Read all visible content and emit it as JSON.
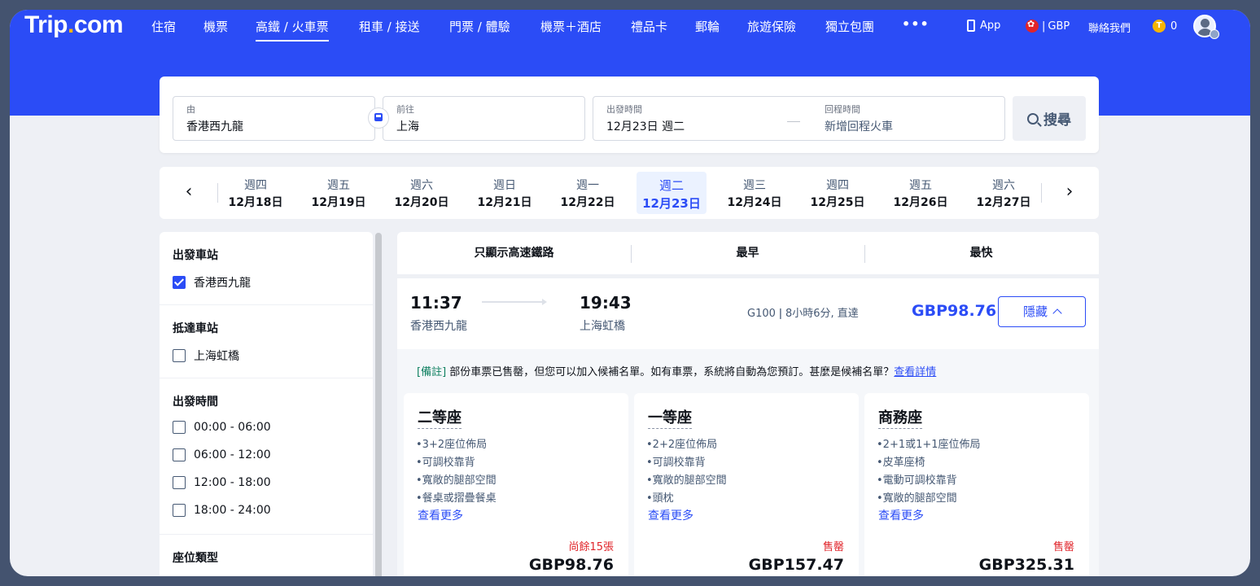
{
  "brand": {
    "name_left": "Trip",
    "name_dot": ".",
    "name_right": "com"
  },
  "nav": {
    "items": [
      {
        "label": "住宿"
      },
      {
        "label": "機票"
      },
      {
        "label": "高鐵 / 火車票",
        "active": true
      },
      {
        "label": "租車 / 接送"
      },
      {
        "label": "門票 / 體驗"
      },
      {
        "label": "機票＋酒店"
      },
      {
        "label": "禮品卡"
      },
      {
        "label": "郵輪"
      },
      {
        "label": "旅遊保險"
      },
      {
        "label": "獨立包團"
      }
    ],
    "more": "•••",
    "app": "App",
    "currency": "GBP",
    "contact": "聯絡我們",
    "coins": "0"
  },
  "search": {
    "from_label": "由",
    "from_value": "香港西九龍",
    "to_label": "前往",
    "to_value": "上海",
    "depart_label": "出發時間",
    "depart_value": "12月23日 週二",
    "return_label": "回程時間",
    "return_value": "新增回程火車",
    "button": "搜尋"
  },
  "dates": [
    {
      "dow": "週四",
      "date": "12月18日"
    },
    {
      "dow": "週五",
      "date": "12月19日"
    },
    {
      "dow": "週六",
      "date": "12月20日"
    },
    {
      "dow": "週日",
      "date": "12月21日"
    },
    {
      "dow": "週一",
      "date": "12月22日"
    },
    {
      "dow": "週二",
      "date": "12月23日",
      "active": true
    },
    {
      "dow": "週三",
      "date": "12月24日"
    },
    {
      "dow": "週四",
      "date": "12月25日"
    },
    {
      "dow": "週五",
      "date": "12月26日"
    },
    {
      "dow": "週六",
      "date": "12月27日"
    }
  ],
  "filters": {
    "depart_station": {
      "title": "出發車站",
      "options": [
        {
          "label": "香港西九龍",
          "checked": true
        }
      ]
    },
    "arrive_station": {
      "title": "抵達車站",
      "options": [
        {
          "label": "上海虹橋",
          "checked": false
        }
      ]
    },
    "depart_time": {
      "title": "出發時間",
      "options": [
        {
          "label": "00:00 - 06:00",
          "checked": false
        },
        {
          "label": "06:00 - 12:00",
          "checked": false
        },
        {
          "label": "12:00 - 18:00",
          "checked": false
        },
        {
          "label": "18:00 - 24:00",
          "checked": false
        }
      ]
    },
    "seat_type": {
      "title": "座位類型"
    }
  },
  "sort": {
    "high_speed": "只顯示高速鐵路",
    "earliest": "最早",
    "fastest": "最快"
  },
  "train": {
    "depart_time": "11:37",
    "depart_station": "香港西九龍",
    "arrive_time": "19:43",
    "arrive_station": "上海虹橋",
    "info": "G100 ǀ 8小時6分, 直達",
    "price": "GBP98.76",
    "hide_button": "隱藏",
    "notice_tag": "[備註]",
    "notice_text": " 部份車票已售罄，但您可以加入候補名單。如有車票，系統將自動為您預訂。甚麼是候補名單？",
    "notice_link": "查看詳情",
    "seats": [
      {
        "name": "二等座",
        "features": [
          "•3+2座位佈局",
          "•可調校靠背",
          "•寬敞的腿部空間",
          "•餐桌或摺疊餐桌"
        ],
        "more": "查看更多",
        "status": "尚餘15張",
        "price": "GBP98.76"
      },
      {
        "name": "一等座",
        "features": [
          "•2+2座位佈局",
          "•可調校靠背",
          "•寬敞的腿部空間",
          "•頭枕"
        ],
        "more": "查看更多",
        "status": "售罄",
        "price": "GBP157.47"
      },
      {
        "name": "商務座",
        "features": [
          "•2+1或1+1座位佈局",
          "•皮革座椅",
          "•電動可調校靠背",
          "•寬敞的腿部空間"
        ],
        "more": "查看更多",
        "status": "售罄",
        "price": "GBP325.31"
      }
    ]
  },
  "colors": {
    "brand_blue": "#2b4cf6",
    "accent_yellow": "#ffb400",
    "sold_red": "#e0242a"
  }
}
